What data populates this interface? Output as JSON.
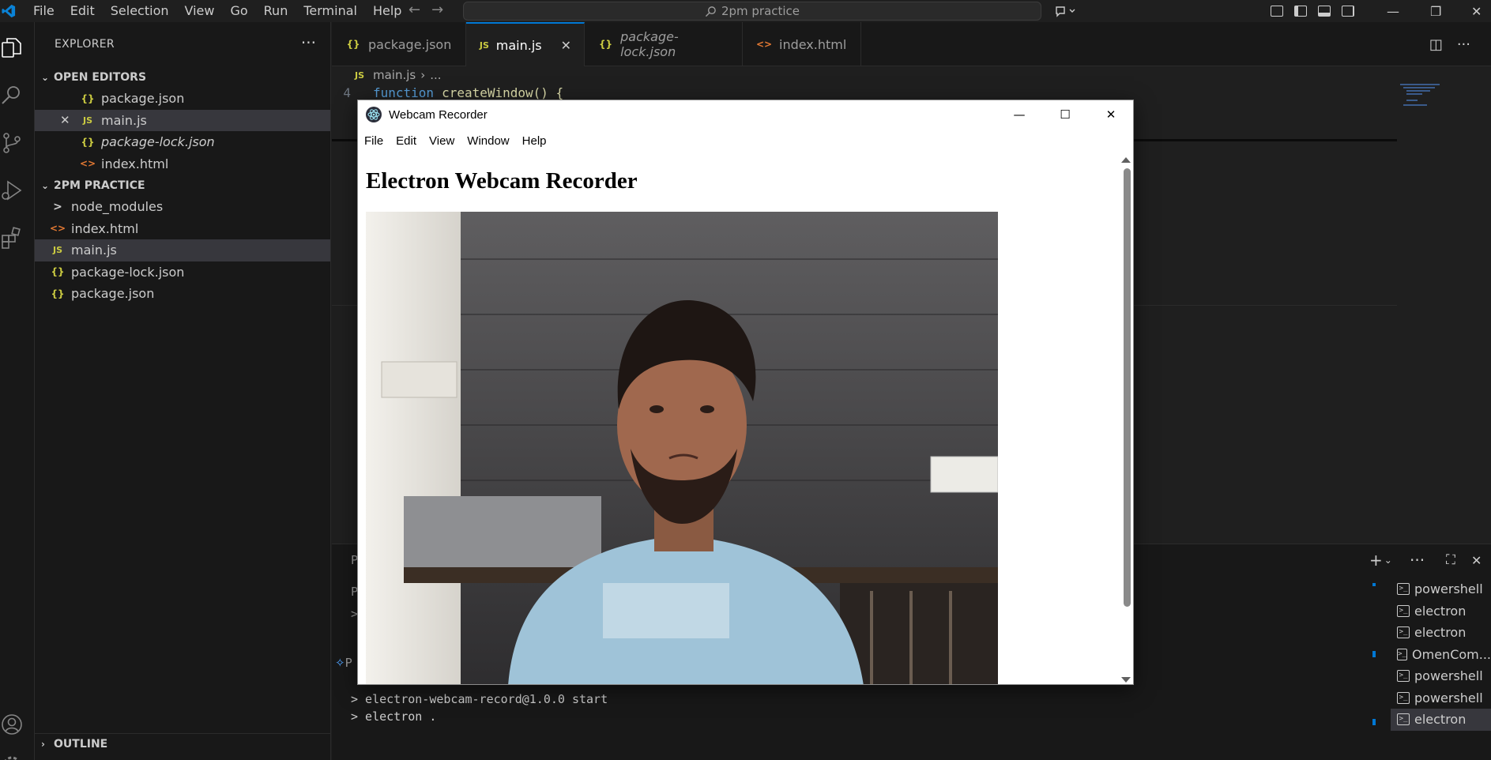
{
  "menubar": [
    "File",
    "Edit",
    "Selection",
    "View",
    "Go",
    "Run",
    "Terminal",
    "Help"
  ],
  "command_center": "2pm practice",
  "sidebar": {
    "title": "EXPLORER",
    "open_editors": {
      "label": "OPEN EDITORS",
      "items": [
        {
          "icon": "{}",
          "name": "package.json"
        },
        {
          "icon": "JS",
          "name": "main.js"
        },
        {
          "icon": "{}",
          "name": "package-lock.json"
        },
        {
          "icon": "<>",
          "name": "index.html"
        }
      ]
    },
    "folder": {
      "label": "2PM PRACTICE",
      "items": [
        {
          "icon": ">",
          "name": "node_modules"
        },
        {
          "icon": "<>",
          "name": "index.html"
        },
        {
          "icon": "JS",
          "name": "main.js"
        },
        {
          "icon": "{}",
          "name": "package-lock.json"
        },
        {
          "icon": "{}",
          "name": "package.json"
        }
      ]
    },
    "outline_label": "OUTLINE"
  },
  "tabs": [
    {
      "icon": "{}",
      "label": "package.json"
    },
    {
      "icon": "JS",
      "label": "main.js"
    },
    {
      "icon": "{}",
      "label": "package-lock.json"
    },
    {
      "icon": "<>",
      "label": "index.html"
    }
  ],
  "breadcrumb": {
    "icon": "JS",
    "file": "main.js",
    "rest": "..."
  },
  "code": {
    "line_number": "4",
    "keyword": "function",
    "text": "createWindow() {"
  },
  "electron_window": {
    "title": "Webcam Recorder",
    "menu": [
      "File",
      "Edit",
      "View",
      "Window",
      "Help"
    ],
    "heading": "Electron Webcam Recorder"
  },
  "terminal": {
    "lines": [
      "> electron-webcam-record@1.0.0 start",
      "> electron ."
    ],
    "partial_labels": [
      "P",
      "P",
      ">",
      "P"
    ],
    "instances": [
      "powershell",
      "electron",
      "electron",
      "OmenCom...",
      "powershell",
      "powershell",
      "electron"
    ]
  },
  "colors": {
    "accent": "#0078d4",
    "background": "#1f1f1f",
    "sidebar": "#181818"
  }
}
